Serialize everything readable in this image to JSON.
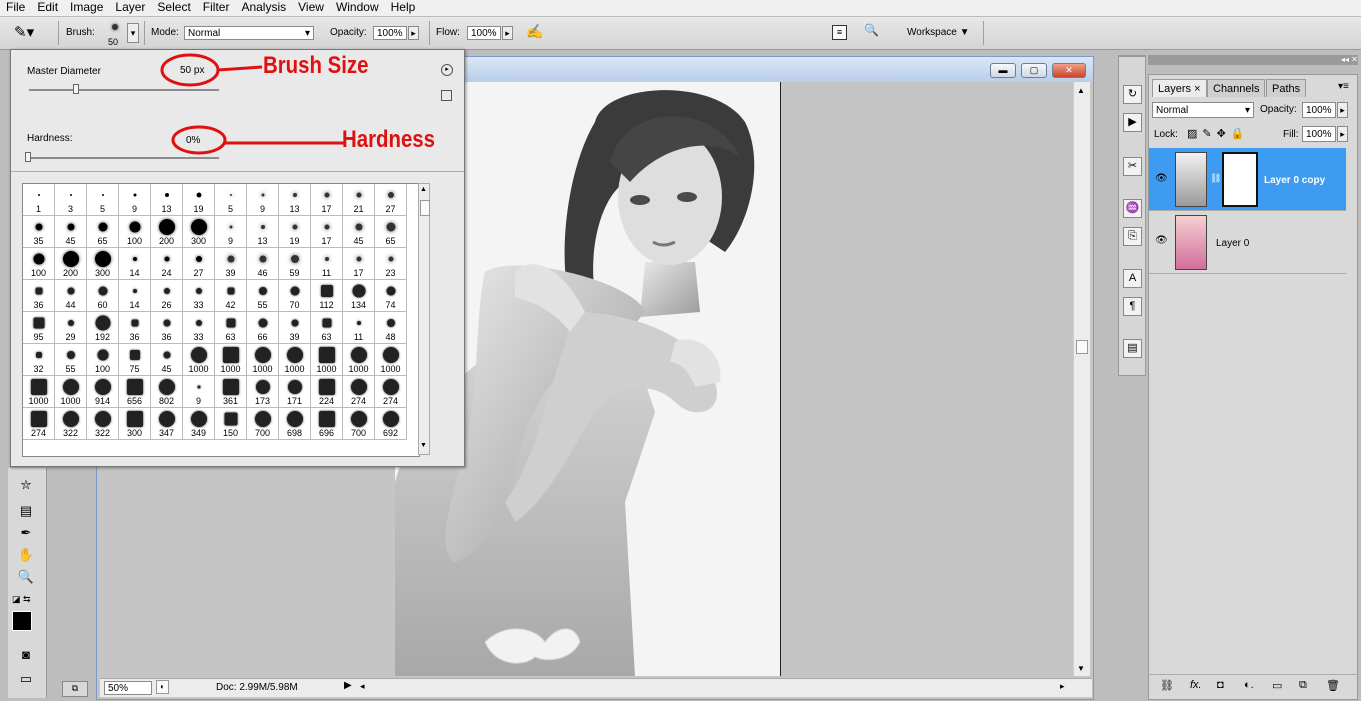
{
  "menu": [
    "File",
    "Edit",
    "Image",
    "Layer",
    "Select",
    "Filter",
    "Analysis",
    "View",
    "Window",
    "Help"
  ],
  "options": {
    "brush_label": "Brush:",
    "brush_size": "50",
    "mode_label": "Mode:",
    "mode_value": "Normal",
    "opacity_label": "Opacity:",
    "opacity_value": "100%",
    "flow_label": "Flow:",
    "flow_value": "100%",
    "workspace_label": "Workspace ▼"
  },
  "brush_popup": {
    "master_label": "Master Diameter",
    "master_value": "50 px",
    "hardness_label": "Hardness:",
    "hardness_value": "0%",
    "annotation_size": "Brush Size",
    "annotation_hardness": "Hardness",
    "presets": [
      "1",
      "3",
      "5",
      "9",
      "13",
      "19",
      "5",
      "9",
      "13",
      "17",
      "21",
      "27",
      "35",
      "45",
      "65",
      "100",
      "200",
      "300",
      "9",
      "13",
      "19",
      "17",
      "45",
      "65",
      "100",
      "200",
      "300",
      "14",
      "24",
      "27",
      "39",
      "46",
      "59",
      "11",
      "17",
      "23",
      "36",
      "44",
      "60",
      "14",
      "26",
      "33",
      "42",
      "55",
      "70",
      "112",
      "134",
      "74",
      "95",
      "29",
      "192",
      "36",
      "36",
      "33",
      "63",
      "66",
      "39",
      "63",
      "11",
      "48",
      "32",
      "55",
      "100",
      "75",
      "45",
      "1000",
      "1000",
      "1000",
      "1000",
      "1000",
      "1000",
      "1000",
      "1000",
      "1000",
      "914",
      "656",
      "802",
      "9",
      "361",
      "173",
      "171",
      "224",
      "274",
      "274",
      "274",
      "322",
      "322",
      "300",
      "347",
      "349",
      "150",
      "700",
      "698",
      "696",
      "700",
      "692"
    ]
  },
  "status": {
    "zoom": "50%",
    "doc": "Doc: 2.99M/5.98M"
  },
  "layers_panel": {
    "tabs": [
      "Layers ×",
      "Channels",
      "Paths"
    ],
    "blend_mode": "Normal",
    "opacity_label": "Opacity:",
    "opacity_value": "100%",
    "lock_label": "Lock:",
    "fill_label": "Fill:",
    "fill_value": "100%",
    "layers": [
      {
        "name": "Layer 0 copy",
        "selected": true
      },
      {
        "name": "Layer 0",
        "selected": false
      }
    ]
  },
  "colors": {
    "selection": "#3d9bf2",
    "annotation": "#e01010"
  }
}
